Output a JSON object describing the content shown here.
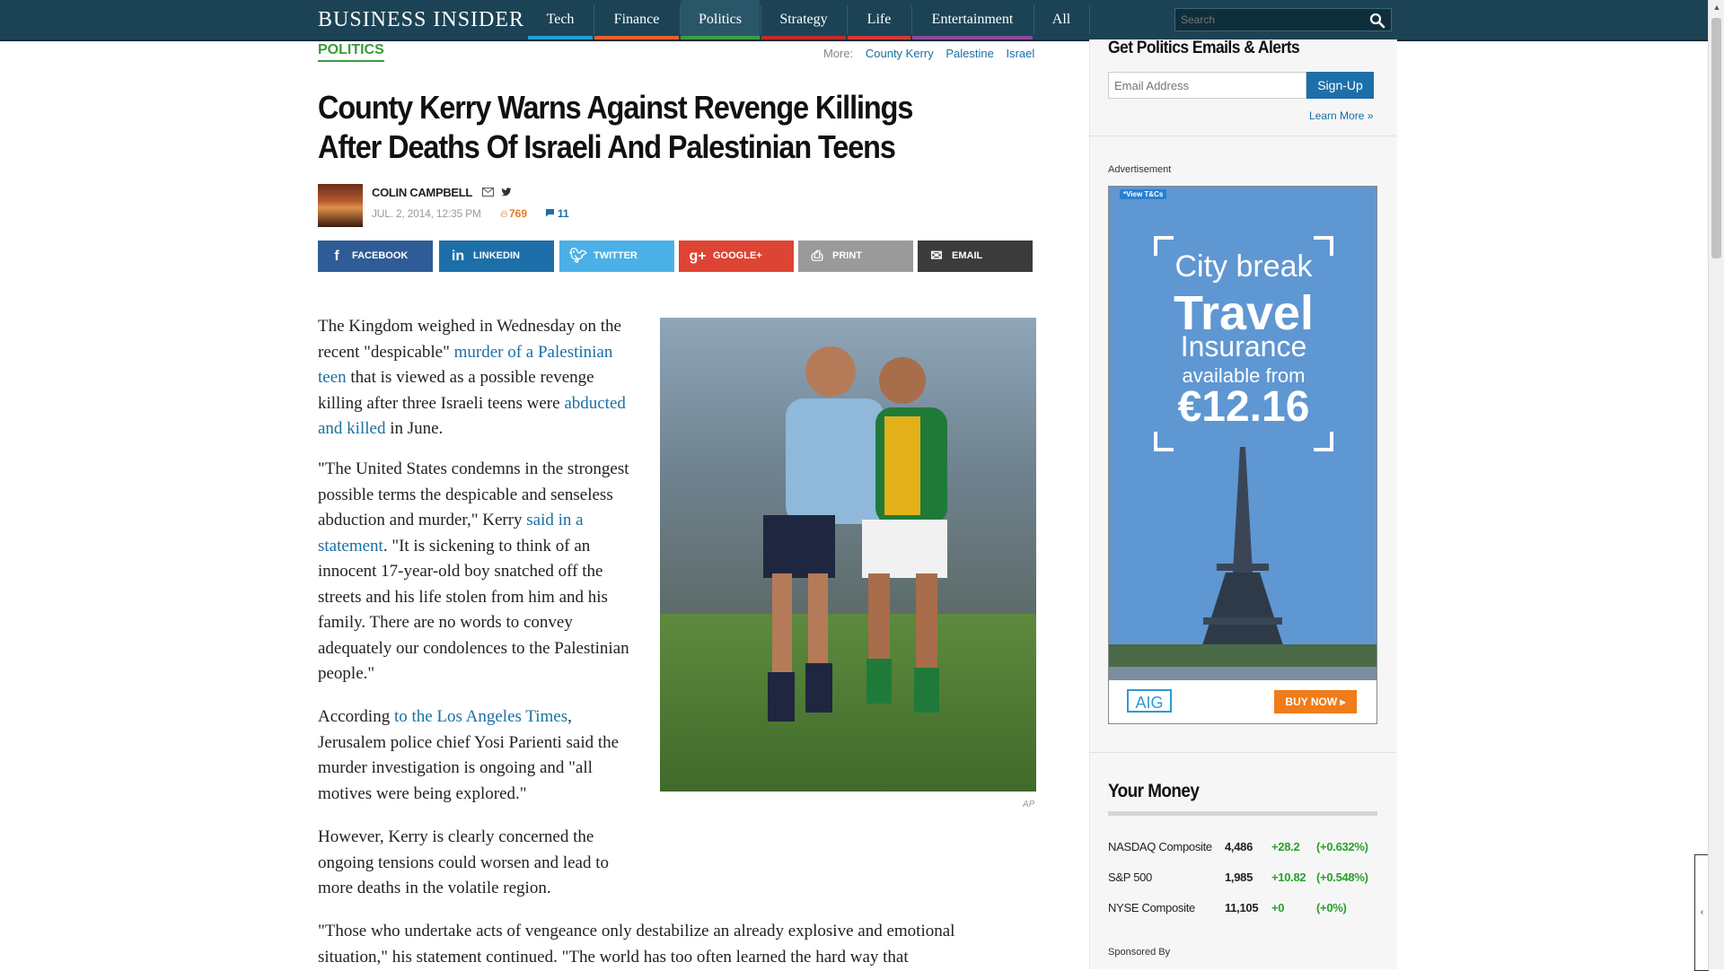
{
  "nav": {
    "logo": "BUSINESS INSIDER",
    "items": [
      {
        "label": "Tech",
        "color": "#1da1d6"
      },
      {
        "label": "Finance",
        "color": "#e8622a"
      },
      {
        "label": "Politics",
        "color": "#3aa040"
      },
      {
        "label": "Strategy",
        "color": "#c02c2c"
      },
      {
        "label": "Life",
        "color": "#d43a3a"
      },
      {
        "label": "Entertainment",
        "color": "#8a4a9a"
      },
      {
        "label": "All",
        "color": "#1c4355"
      }
    ],
    "search_placeholder": "Search"
  },
  "article": {
    "section": "POLITICS",
    "more_label": "More:",
    "tags": [
      "County Kerry",
      "Palestine",
      "Israel"
    ],
    "headline": "County Kerry Warns Against Revenge Killings After Deaths Of Israeli And Palestinian Teens",
    "author": "COLIN CAMPBELL",
    "date": "JUL. 2, 2014, 12:35 PM",
    "views": "769",
    "comments": "11",
    "share_buttons": [
      "FACEBOOK",
      "LINKEDIN",
      "TWITTER",
      "GOOGLE+",
      "PRINT",
      "EMAIL"
    ],
    "photo_credit": "AP",
    "p1": {
      "a": "The Kingdom weighed in Wednesday on the recent \"despicable\" ",
      "link1": "murder of a Palestinian teen",
      "b": " that is viewed as a possible revenge killing after three Israeli teens were ",
      "link2": "abducted and killed",
      "c": " in June."
    },
    "p2": {
      "a": "\"The United States condemns in the strongest possible terms the despicable and senseless abduction and murder,\" Kerry ",
      "link": "said in a statement",
      "b": ". \"It is sickening to think of an innocent 17-year-old boy snatched off the streets and his life stolen from him and his family. There are no words to convey adequately our condolences to the Palestinian people.\""
    },
    "p3": {
      "a": "According ",
      "link": "to the Los Angeles Times",
      "b": ", Jerusalem police chief Yosi Parienti said the murder investigation is ongoing and \"all motives were being explored.\""
    },
    "p4": "However, Kerry is clearly concerned the ongoing tensions could worsen and lead to more deaths in the volatile region.",
    "p5": "\"Those who undertake acts of vengeance only destabilize an already explosive and emotional situation,\" his statement continued. \"The world has too often learned the hard way that"
  },
  "sidebar": {
    "alerts_title": "Get Politics Emails & Alerts",
    "email_placeholder": "Email Address",
    "signup_label": "Sign-Up",
    "learn_more": "Learn More »",
    "ad_label": "Advertisement",
    "ad": {
      "tc": "*View T&Cs",
      "line1": "City break",
      "line2": "Travel",
      "line3": "Insurance",
      "line4": "available from",
      "price": "€12.16",
      "brand": "AIG",
      "cta": "BUY NOW ▸"
    },
    "money_title": "Your Money",
    "markets": [
      {
        "name": "NASDAQ Composite",
        "value": "4,486",
        "change": "+28.2",
        "pct": "(+0.632%)"
      },
      {
        "name": "S&P 500",
        "value": "1,985",
        "change": "+10.82",
        "pct": "(+0.548%)"
      },
      {
        "name": "NYSE Composite",
        "value": "11,105",
        "change": "+0",
        "pct": "(+0%)"
      }
    ],
    "sponsored": "Sponsored By"
  }
}
